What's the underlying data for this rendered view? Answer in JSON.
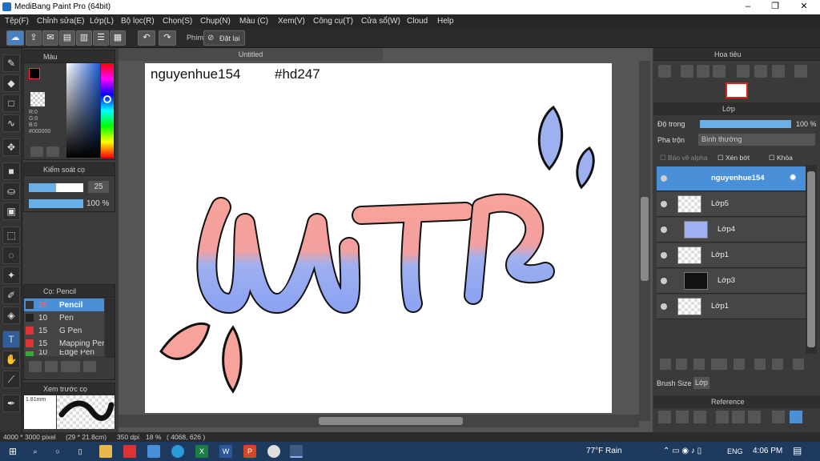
{
  "window": {
    "title": "MediBang Paint Pro (64bit)",
    "min": "–",
    "max": "❐",
    "close": "✕"
  },
  "menu": [
    "Tệp(F)",
    "Chỉnh sửa(E)",
    "Lớp(L)",
    "Bộ lọc(R)",
    "Chọn(S)",
    "Chụp(N)",
    "Màu (C)",
    "Xem(V)",
    "Công cụ(T)",
    "Cửa sổ(W)",
    "Cloud",
    "Help"
  ],
  "toolbar": {
    "key_label": "Phím",
    "reset_label": "Đặt lại"
  },
  "color_panel": {
    "title": "Màu",
    "r": "R:0",
    "g": "G:0",
    "b": "B:0",
    "hex": "#000000"
  },
  "brush_control": {
    "title": "Kiểm soát cọ",
    "size": "25",
    "opacity": "100 %"
  },
  "brush_panel": {
    "title": "Cọ: Pencil",
    "items": [
      {
        "size": "25",
        "name": "Pencil"
      },
      {
        "size": "10",
        "name": "Pen"
      },
      {
        "size": "15",
        "name": "G Pen"
      },
      {
        "size": "15",
        "name": "Mapping Pen"
      },
      {
        "size": "10",
        "name": "Edge Pen"
      }
    ]
  },
  "preview": {
    "title": "Xem trước cọ",
    "size": "1.81mm"
  },
  "canvas": {
    "tab": "Untitled",
    "text1": "nguyenhue154",
    "text2": "#hd247"
  },
  "navigator": {
    "title": "Hoa tiêu"
  },
  "layer_panel": {
    "title": "Lớp",
    "opacity_label": "Độ trong",
    "opacity_value": "100 %",
    "blend_label": "Pha trộn",
    "blend_value": "Bình thường",
    "protect_alpha": "Bảo vệ alpha",
    "clipping": "Xén bớt",
    "lock": "Khóa"
  },
  "layers": [
    "nguyenhue154",
    "Lớp5",
    "Lớp4",
    "Lớp1",
    "Lớp3",
    "Lớp1"
  ],
  "bottom_tabs": [
    "Brush Size",
    "Lớp"
  ],
  "reference": {
    "title": "Reference"
  },
  "status": {
    "size": "4000 * 3000 pixel",
    "cm": "(29 * 21.8cm)",
    "dpi": "350 dpi",
    "zoom": "18 %",
    "coords": "( 4068, 626 )"
  },
  "taskbar": {
    "weather": "77°F  Rain",
    "lang": "ENG",
    "time": "4:06 PM"
  }
}
